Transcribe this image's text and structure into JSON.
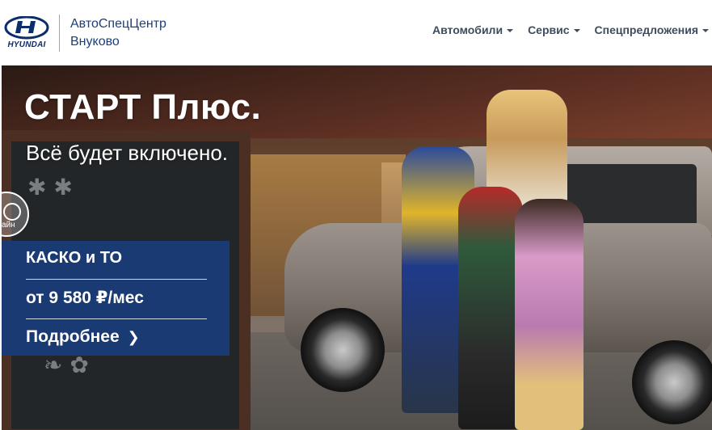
{
  "header": {
    "logo_text": "HYUNDAI",
    "dealer_line1": "АвтоСпецЦентр",
    "dealer_line2": "Внуково",
    "nav": [
      {
        "label": "Автомобили"
      },
      {
        "label": "Сервис"
      },
      {
        "label": "Спецпредложения"
      }
    ]
  },
  "hero": {
    "title": "СТАРТ Плюс.",
    "subtitle": "Всё будет включено.",
    "side_widget_label": "айн",
    "promo": {
      "title": "КАСКО и ТО",
      "price": "от 9 580 ₽/мес",
      "link": "Подробнее",
      "link_icon": "chevron-right-icon"
    }
  },
  "colors": {
    "brand_blue": "#1a3a74",
    "nav_text": "#3e4c5e",
    "dealer_text": "#1c3f78"
  }
}
